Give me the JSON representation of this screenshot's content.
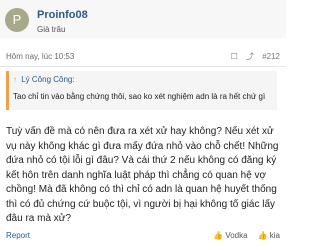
{
  "user": {
    "avatar_letter": "P",
    "name": "Proinfo08",
    "title": "Già trâu"
  },
  "meta": {
    "date": "Hôm nay, lúc 10:53",
    "post_number": "#212"
  },
  "quote": {
    "author": "Lý Công Công:",
    "text": "Tao chỉ tin vào bằng chứng thôi, sao ko xét nghiệm adn là ra hết chứ gì"
  },
  "post": {
    "text": "Tuỳ vấn đề mà có nên đưa ra xét xử hay không? Nếu xét xử vụ này không khác gì đưa mấy đứa nhỏ vào chỗ chết! Những đứa nhỏ có tội lỗi gì đâu? Và cái thứ 2 nếu không có đăng ký kết hôn trên danh nghĩa luật pháp thì chẳng có quan hệ vợ chồng! Mà đã không có thì chỉ có adn là quan hệ huyết thống thì có đủ chứng cứ buộc tội, vì người bị hại không tố giác lấy đâu ra mà xử?"
  },
  "footer": {
    "report": "Report",
    "reactions": [
      {
        "icon": "thumbs-up-icon",
        "label": "Vodka"
      },
      {
        "icon": "thumbs-up-icon",
        "label": "kia"
      }
    ]
  }
}
